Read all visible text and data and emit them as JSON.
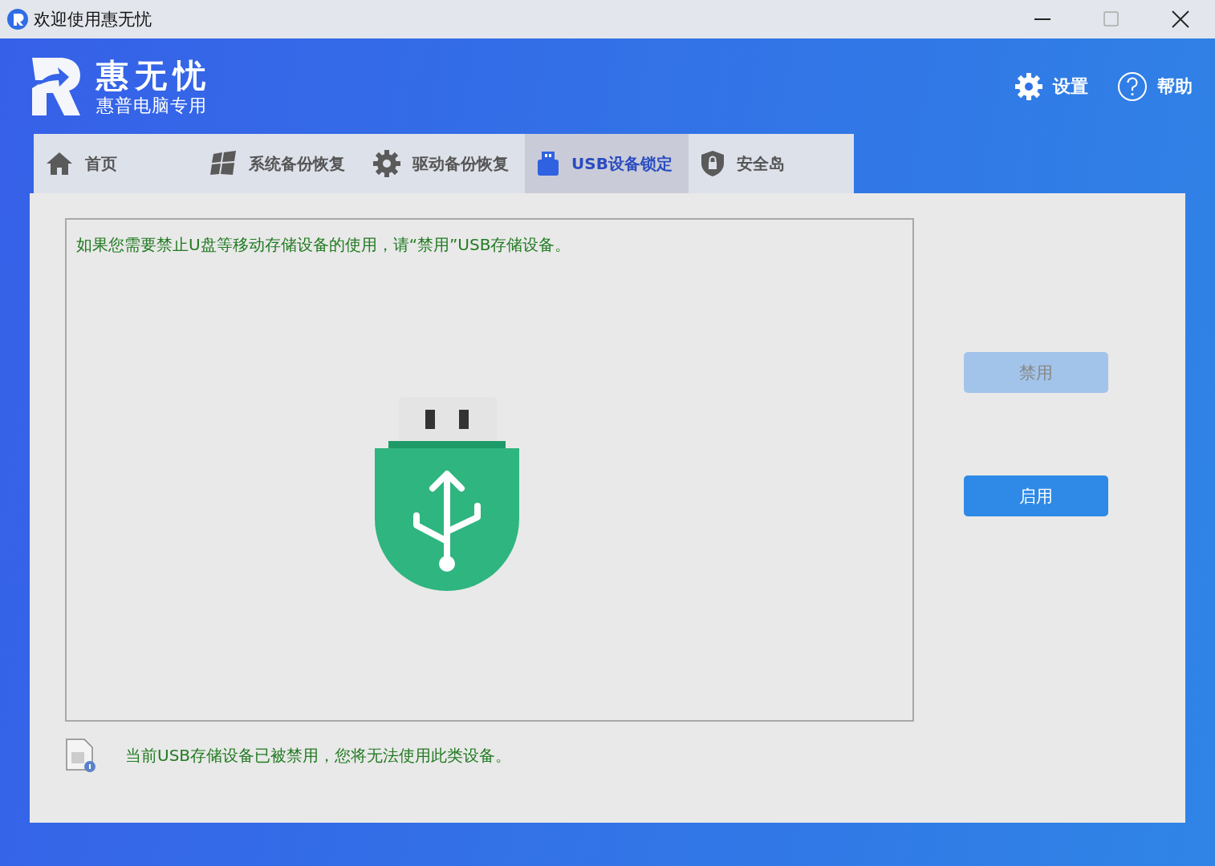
{
  "window": {
    "title": "欢迎使用惠无忧"
  },
  "brand": {
    "name": "惠无忧",
    "subtitle": "惠普电脑专用"
  },
  "header_actions": [
    {
      "kind": "settings",
      "label": "设置"
    },
    {
      "kind": "help",
      "label": "帮助"
    }
  ],
  "tabs": [
    {
      "kind": "home",
      "label": "首页",
      "selected": false
    },
    {
      "kind": "windows",
      "label": "系统备份恢复",
      "selected": false
    },
    {
      "kind": "gear",
      "label": "驱动备份恢复",
      "selected": false
    },
    {
      "kind": "usb",
      "label": "USB设备锁定",
      "selected": true
    },
    {
      "kind": "shield",
      "label": "安全岛",
      "selected": false
    }
  ],
  "message": "如果您需要禁止U盘等移动存储设备的使用，请“禁用”USB存储设备。",
  "buttons": [
    {
      "label": "禁用",
      "disabled": true
    },
    {
      "label": "启用",
      "disabled": false
    }
  ],
  "status": "当前USB存储设备已被禁用，您将无法使用此类设备。"
}
